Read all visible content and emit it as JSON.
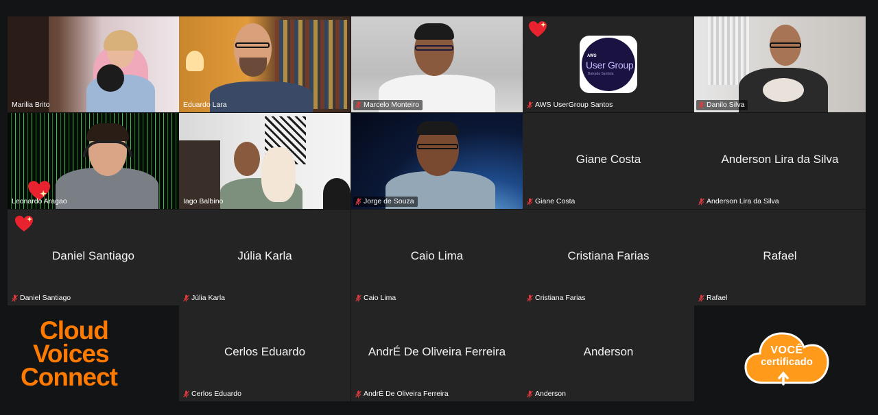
{
  "tiles": [
    {
      "name": "Marilia Brito"
    },
    {
      "name": "Eduardo Lara"
    },
    {
      "name": "Marcelo Monteiro"
    },
    {
      "name": "AWS UserGroup Santos"
    },
    {
      "name": "Danilo Silva"
    },
    {
      "name": "Leonardo Aragao"
    },
    {
      "name": "Iago Balbino"
    },
    {
      "name": "Jorge de Souza"
    },
    {
      "name": "Giane Costa"
    },
    {
      "name": "Anderson Lira da Silva"
    },
    {
      "name": "Daniel Santiago"
    },
    {
      "name": "Júlia Karla"
    },
    {
      "name": "Caio Lima"
    },
    {
      "name": "Cristiana Farias"
    },
    {
      "name": "Rafael"
    },
    {
      "name": "Cerlos Eduardo"
    },
    {
      "name": "AndrÉ De Oliveira Ferreira"
    },
    {
      "name": "Anderson"
    }
  ],
  "aws_logo": {
    "small": "AWS",
    "big": "User Group",
    "sub": "Baixada Santista"
  },
  "branding": {
    "line1": "Cloud",
    "line2": "Voices",
    "line3": "Connect"
  },
  "certificado": {
    "top": "VOCÊ",
    "bottom": "certificado"
  },
  "colors": {
    "brand_orange": "#ff7a00",
    "tile_bg": "#242424",
    "page_bg": "#121416",
    "muted_red": "#e0393e",
    "active_border": "#2e9e3e"
  }
}
